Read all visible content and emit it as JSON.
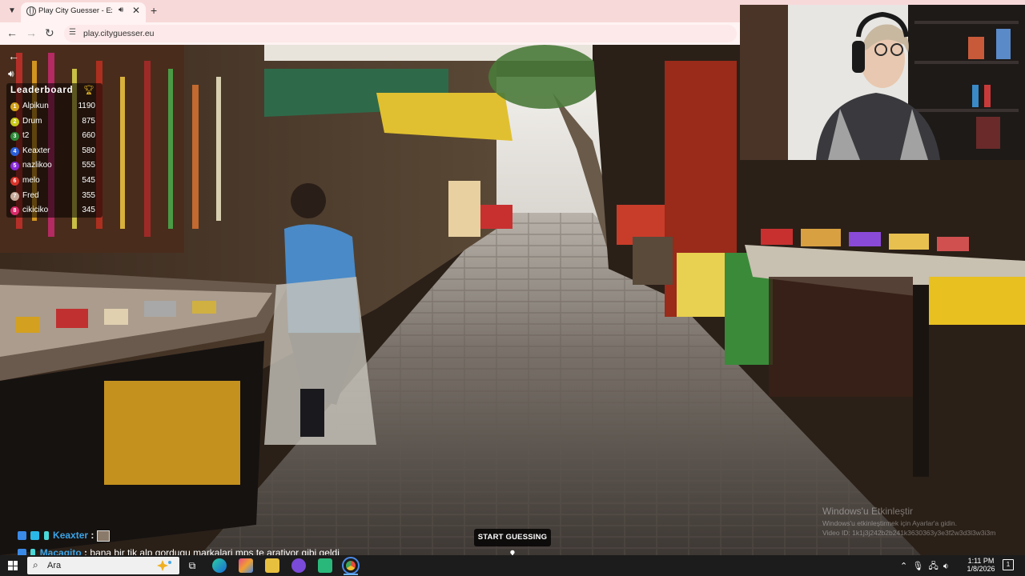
{
  "browser": {
    "tab_title": "Play City Guesser - Explore",
    "tab_audio_icon": "speaker-icon",
    "tab_close_icon": "close-icon",
    "new_tab_icon": "plus-icon",
    "url": "play.cityguesser.eu"
  },
  "game": {
    "leaderboard_title": "Leaderboard",
    "leaderboard": [
      {
        "rank": "1",
        "name": "Alpikun",
        "score": "1190",
        "color": "#d4a21a"
      },
      {
        "rank": "2",
        "name": "Drum",
        "score": "875",
        "color": "#c8c81a"
      },
      {
        "rank": "3",
        "name": "t2",
        "score": "660",
        "color": "#2e8b3a"
      },
      {
        "rank": "4",
        "name": "Keaxter",
        "score": "580",
        "color": "#2b5fd9"
      },
      {
        "rank": "5",
        "name": "nazlikoo",
        "score": "555",
        "color": "#8a2bd9"
      },
      {
        "rank": "6",
        "name": "melo",
        "score": "545",
        "color": "#d9342b"
      },
      {
        "rank": "7",
        "name": "Fred",
        "score": "355",
        "color": "#c8a89a"
      },
      {
        "rank": "8",
        "name": "cikiciko",
        "score": "345",
        "color": "#d92b6a"
      }
    ],
    "start_button": "START GUESSING",
    "start_icon": "map-pin-icon"
  },
  "chat": [
    {
      "user": "Keaxter",
      "separator": ":",
      "message": ""
    },
    {
      "user": "Macagito",
      "separator": ":",
      "message": "bana bir tik alp gordugu markalari mps te aratiyor gibi geldi"
    }
  ],
  "watermark": {
    "title": "Windows'u Etkinleştir",
    "subtitle": "Windows'u etkinleştirmek için Ayarlar'a gidin.",
    "video_id": "Video ID: 1k1j3j242b2b241k3630363y3e3f2w3d3l3w3i3m"
  },
  "taskbar": {
    "search_placeholder": "Ara",
    "time": "1:11 PM",
    "date": "1/8/2026",
    "notifications": "1"
  }
}
